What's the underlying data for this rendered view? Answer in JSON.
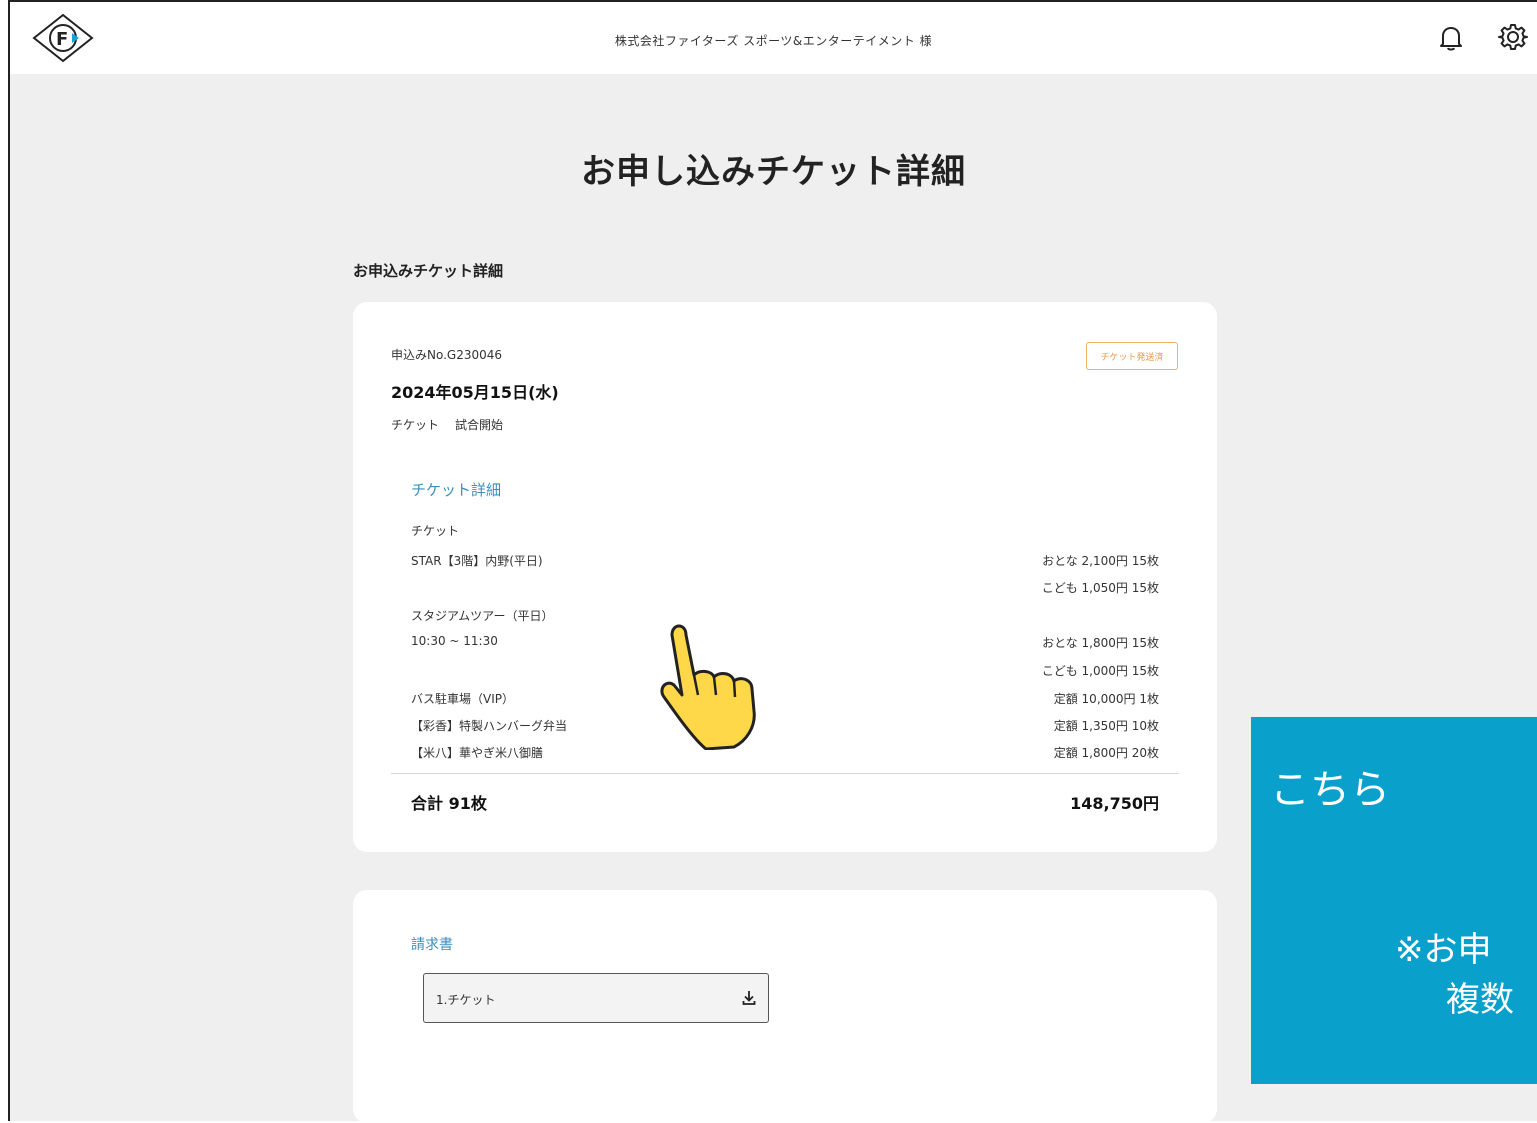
{
  "header": {
    "company": "株式会社ファイターズ スポーツ&エンターテイメント 様",
    "logo_letter": "F"
  },
  "page": {
    "title": "お申し込みチケット詳細",
    "section_title": "お申込みチケット詳細"
  },
  "application": {
    "number": "申込みNo.G230046",
    "status": "チケット発送済",
    "date": "2024年05月15日(水)",
    "type": "チケット",
    "event": "試合開始"
  },
  "ticket_details": {
    "heading": "チケット詳細",
    "ticket_label": "チケット",
    "rows": [
      {
        "name": "STAR【3階】内野(平日)",
        "price": "おとな 2,100円 15枚"
      },
      {
        "name": "",
        "price": "こども 1,050円 15枚"
      },
      {
        "name": "スタジアムツアー（平日）",
        "price": ""
      },
      {
        "name": "10:30 ~ 11:30",
        "price": "おとな 1,800円 15枚"
      },
      {
        "name": "",
        "price": "こども 1,000円 15枚"
      },
      {
        "name": "バス駐車場（VIP）",
        "price": "定額 10,000円 1枚"
      },
      {
        "name": "【彩香】特製ハンバーグ弁当",
        "price": "定額 1,350円 10枚"
      },
      {
        "name": "【米八】華やぎ米八御膳",
        "price": "定額 1,800円 20枚"
      }
    ],
    "total_label": "合計 91枚",
    "total_amount": "148,750円"
  },
  "invoice": {
    "heading": "請求書",
    "button_label": "1.チケット"
  },
  "callout": {
    "line1": "こちら",
    "line2": "※お申",
    "line3": "複数"
  },
  "icons": {
    "bell": "bell-icon",
    "gear": "gear-icon",
    "download": "download-icon",
    "pointer": "hand-pointer-icon"
  },
  "colors": {
    "accent_blue": "#3a8fbd",
    "status_orange": "#e89a4a",
    "callout_bg": "#0aa0cc",
    "page_bg": "#efefef"
  }
}
